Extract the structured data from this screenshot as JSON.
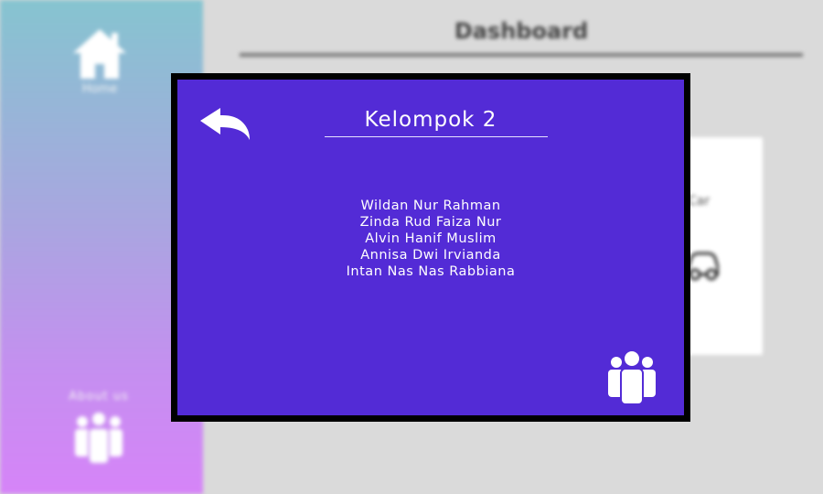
{
  "background": {
    "sidebar": {
      "home_label": "Home",
      "about_label": "About us"
    },
    "main": {
      "title": "Dashboard",
      "card_label": "Car"
    }
  },
  "modal": {
    "title": "Kelompok 2",
    "members": [
      "Wildan Nur Rahman",
      "Zinda Rud Faiza Nur",
      "Alvin Hanif Muslim",
      "Annisa Dwi Irvianda",
      "Intan Nas Nas Rabbiana"
    ]
  },
  "icons": {
    "back": "back-arrow-icon",
    "team": "group-people-icon",
    "home": "home-icon",
    "car": "car-icon"
  },
  "colors": {
    "modal_bg": "#532bd6",
    "modal_border": "#000000",
    "sidebar_top": "#86c4d0",
    "sidebar_bottom": "#d684f8",
    "page_bg": "#dadada"
  }
}
